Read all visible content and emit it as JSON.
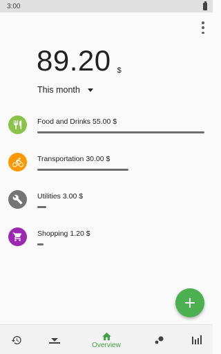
{
  "status_bar": {
    "time": "3:00"
  },
  "summary": {
    "total": "89.20",
    "currency": "$",
    "period": "This month"
  },
  "categories": [
    {
      "name": "Food and Drinks",
      "amount": "55.00 $",
      "icon": "restaurant-icon",
      "color": "#8bc34a",
      "share": 1.0
    },
    {
      "name": "Transportation",
      "amount": "30.00 $",
      "icon": "bike-icon",
      "color": "#ff9800",
      "share": 0.545
    },
    {
      "name": "Utilities",
      "amount": "3.00 $",
      "icon": "wrench-icon",
      "color": "#757575",
      "share": 0.055
    },
    {
      "name": "Shopping",
      "amount": "1.20 $",
      "icon": "cart-icon",
      "color": "#9c27b0",
      "share": 0.022
    }
  ],
  "bottom_nav": {
    "items": [
      {
        "icon": "history-icon"
      },
      {
        "icon": "filter-icon"
      },
      {
        "icon": "home-icon",
        "label": "Overview",
        "active": true
      },
      {
        "icon": "bubbles-icon"
      },
      {
        "icon": "bar-chart-icon"
      }
    ]
  },
  "colors": {
    "accent": "#4caf50",
    "bar": "#6d6d6d"
  }
}
